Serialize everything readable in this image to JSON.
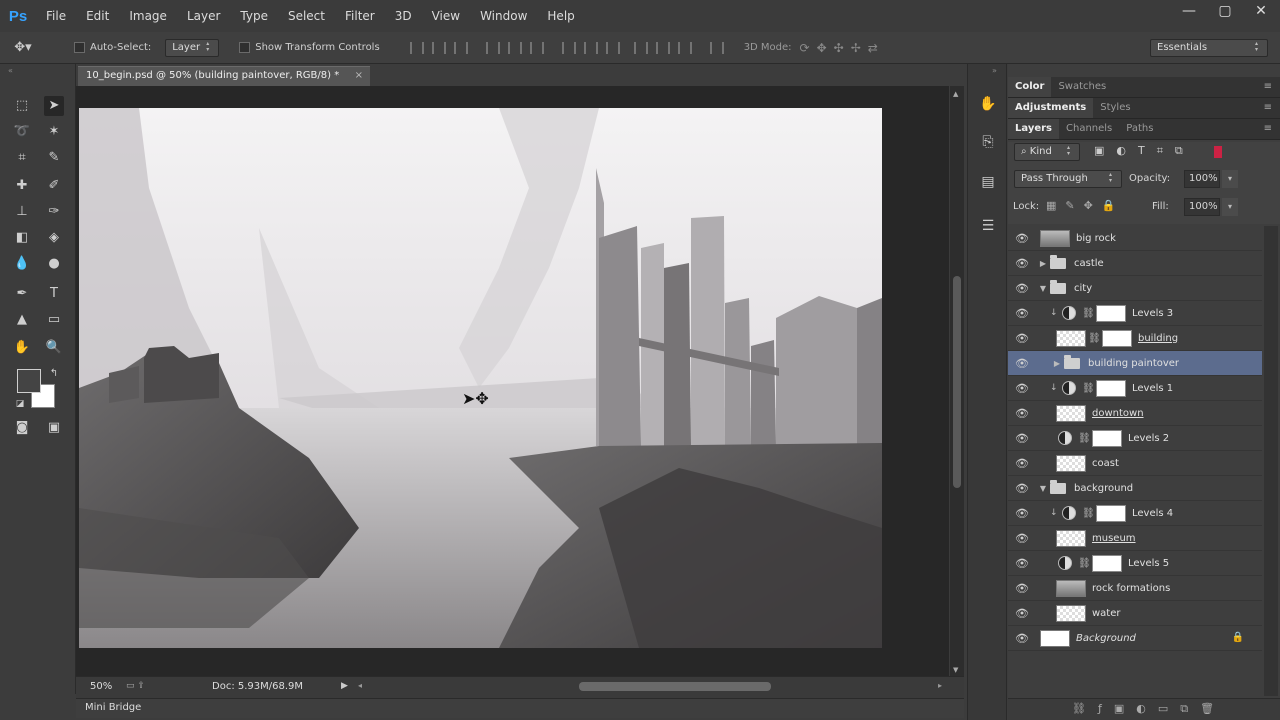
{
  "app": {
    "logo": "Ps"
  },
  "menu": [
    "File",
    "Edit",
    "Image",
    "Layer",
    "Type",
    "Select",
    "Filter",
    "3D",
    "View",
    "Window",
    "Help"
  ],
  "window_controls": {
    "minimize": "—",
    "maximize": "▢",
    "close": "✕"
  },
  "options": {
    "auto_select_label": "Auto-Select:",
    "auto_select_value": "Layer",
    "transform_label": "Show Transform Controls",
    "mode_3d_label": "3D Mode:",
    "workspace": "Essentials"
  },
  "document": {
    "tab_title": "10_begin.psd @ 50% (building paintover, RGB/8) *",
    "close": "×"
  },
  "status": {
    "zoom": "50%",
    "doc_info": "Doc: 5.93M/68.9M"
  },
  "mini_bridge": "Mini Bridge",
  "panels": {
    "top_tabs": [
      "Color",
      "Swatches"
    ],
    "mid_tabs": [
      "Adjustments",
      "Styles"
    ],
    "layer_tabs": [
      "Layers",
      "Channels",
      "Paths"
    ],
    "filter_kind": "Kind",
    "blend_mode": "Pass Through",
    "opacity_label": "Opacity:",
    "opacity_value": "100%",
    "lock_label": "Lock:",
    "fill_label": "Fill:",
    "fill_value": "100%"
  },
  "layers": [
    {
      "name": "big rock",
      "type": "pixel"
    },
    {
      "name": "castle",
      "type": "group-closed"
    },
    {
      "name": "city",
      "type": "group-open"
    },
    {
      "name": "Levels 3",
      "type": "adjust-clip"
    },
    {
      "name": "building",
      "type": "pixel-mask"
    },
    {
      "name": "building paintover",
      "type": "group-selected"
    },
    {
      "name": "Levels 1",
      "type": "adjust-clip"
    },
    {
      "name": "downtown",
      "type": "pixel-u"
    },
    {
      "name": "Levels 2",
      "type": "adjust"
    },
    {
      "name": "coast",
      "type": "pixel"
    },
    {
      "name": "background",
      "type": "group-open"
    },
    {
      "name": "Levels 4",
      "type": "adjust-clip"
    },
    {
      "name": "museum",
      "type": "pixel-u"
    },
    {
      "name": "Levels 5",
      "type": "adjust"
    },
    {
      "name": "rock formations",
      "type": "pixel-dark"
    },
    {
      "name": "water",
      "type": "pixel"
    },
    {
      "name": "Background",
      "type": "background"
    }
  ]
}
